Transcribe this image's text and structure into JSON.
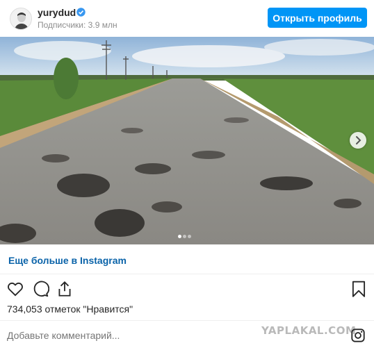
{
  "header": {
    "username": "yurydud",
    "followers": "Подписчики: 3.9 млн",
    "open_profile": "Открыть профиль"
  },
  "photo": {
    "carousel_dots": 3,
    "active_dot": 1
  },
  "more_link": "Еще больше в Instagram",
  "likes": "734,053 отметок \"Нравится\"",
  "comment_placeholder": "Добавьте комментарий...",
  "watermark": "YAPLAKAL.COM",
  "icons": [
    "heart-icon",
    "comment-icon",
    "share-icon",
    "bookmark-icon",
    "instagram-icon",
    "verified-icon",
    "chevron-right-icon"
  ],
  "colors": {
    "accent": "#0095f6",
    "link": "#0a63a9",
    "muted": "#8e8e8e"
  }
}
